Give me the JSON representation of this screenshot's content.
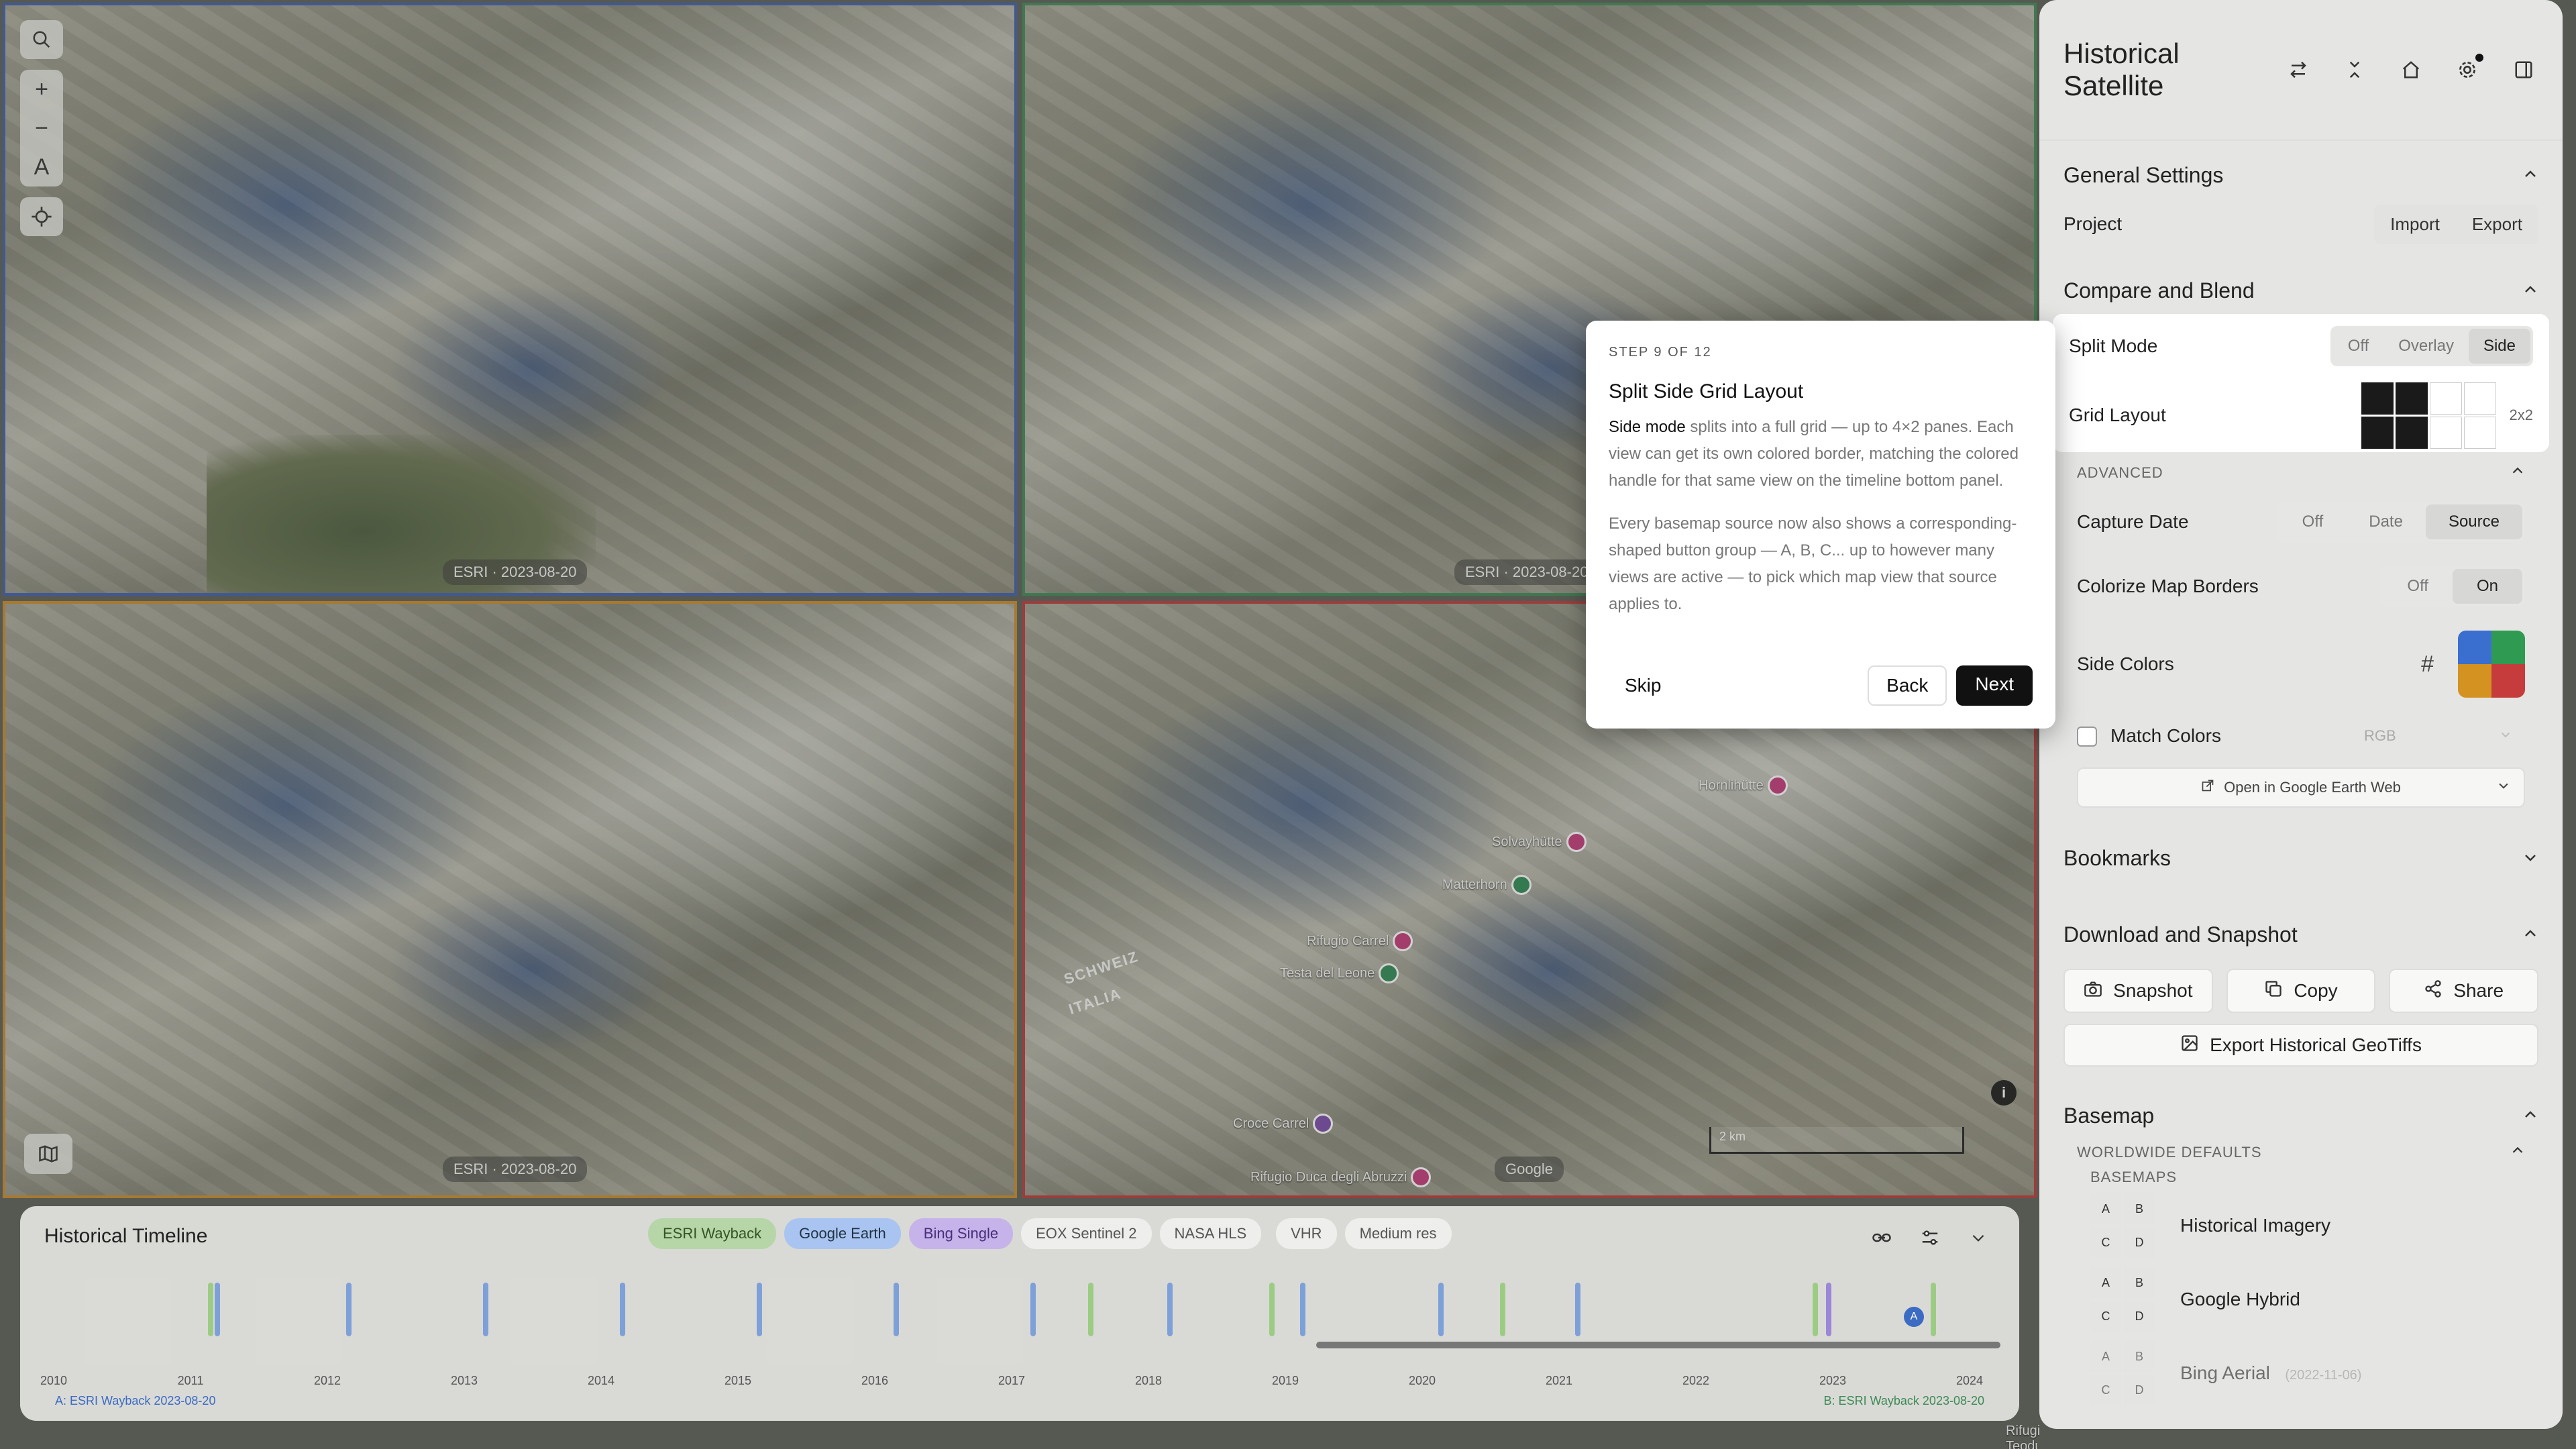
{
  "map": {
    "pane_labels": [
      "ESRI · 2023-08-20",
      "ESRI · 2023-08-20",
      "ESRI · 2023-08-20",
      "Google"
    ],
    "border_colors": [
      "#3f5fae",
      "#3e8a55",
      "#c98a2a",
      "#b83a3a"
    ],
    "pois": [
      "Hornlihütte",
      "Solvayhütte",
      "Matterhorn",
      "Rifugio Carrel",
      "Testa del Leone",
      "Croce Carrel",
      "Rifugio Duca degli Abruzzi",
      "Rifugio Teodulo"
    ],
    "map_words": [
      "SCHWEIZ",
      "ITALIA"
    ],
    "scale": "2 km",
    "info": "i",
    "controls": {
      "search_icon": "search-icon",
      "zoom_in": "+",
      "zoom_out": "−",
      "north": "A",
      "locate_icon": "locate-icon"
    }
  },
  "timeline": {
    "title": "Historical Timeline",
    "chips": [
      "ESRI Wayback",
      "Google Earth",
      "Bing Single",
      "EOX Sentinel 2",
      "NASA HLS",
      "VHR",
      "Medium res"
    ],
    "years": [
      "2010",
      "2011",
      "2012",
      "2013",
      "2014",
      "2015",
      "2016",
      "2017",
      "2018",
      "2019",
      "2020",
      "2021",
      "2022",
      "2023",
      "2024"
    ],
    "handle_label": "A",
    "footer_a": "A: ESRI Wayback 2023-08-20",
    "footer_b": "B: ESRI Wayback 2023-08-20"
  },
  "sidebar": {
    "title": "Historical Satellite",
    "general": {
      "title": "General Settings",
      "project_label": "Project",
      "import": "Import",
      "export": "Export"
    },
    "compare": {
      "title": "Compare and Blend",
      "split_mode_label": "Split Mode",
      "split_options": [
        "Off",
        "Overlay",
        "Side"
      ],
      "grid_layout_label": "Grid Layout",
      "grid_value": "2x2",
      "advanced_label": "ADVANCED",
      "capture_date_label": "Capture Date",
      "capture_options": [
        "Off",
        "Date",
        "Source"
      ],
      "colorize_label": "Colorize Map Borders",
      "colorize_options": [
        "Off",
        "On"
      ],
      "side_colors_label": "Side Colors",
      "side_colors_hash": "#",
      "match_colors_label": "Match Colors",
      "match_colors_value": "RGB",
      "open_google_earth": "Open in Google Earth Web"
    },
    "bookmarks_title": "Bookmarks",
    "download": {
      "title": "Download and Snapshot",
      "snapshot": "Snapshot",
      "copy": "Copy",
      "share": "Share",
      "export_geotiffs": "Export Historical GeoTiffs"
    },
    "basemap": {
      "title": "Basemap",
      "worldwide_label": "WORLDWIDE DEFAULTS",
      "basemaps_label": "BASEMAPS",
      "abcd": [
        "A",
        "B",
        "C",
        "D"
      ],
      "items": [
        {
          "name": "Historical Imagery",
          "date": ""
        },
        {
          "name": "Google Hybrid",
          "date": ""
        },
        {
          "name": "Bing Aerial",
          "date": "(2022-11-06)"
        }
      ]
    }
  },
  "tour": {
    "step": "STEP 9 OF 12",
    "title": "Split Side Grid Layout",
    "p1_bold": "Side mode",
    "p1_rest": " splits into a full grid — up to 4×2 panes. Each view can get its own colored border, matching the colored handle for that same view on the timeline bottom panel.",
    "p2": "Every basemap source now also shows a corresponding-shaped button group — A, B, C... up to however many views are active — to pick which map view that source applies to.",
    "skip": "Skip",
    "back": "Back",
    "next": "Next"
  }
}
